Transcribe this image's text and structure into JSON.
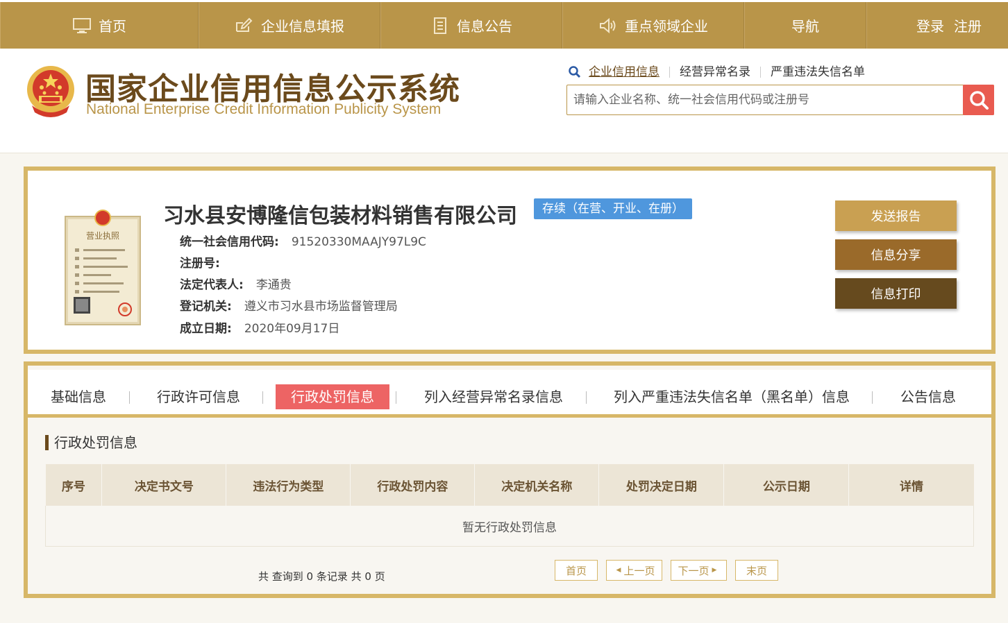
{
  "nav": {
    "home": "首页",
    "report": "企业信息填报",
    "notice": "信息公告",
    "key": "重点领域企业",
    "guide": "导航",
    "login": "登录",
    "register": "注册"
  },
  "header": {
    "title": "国家企业信用信息公示系统",
    "subtitle": "National Enterprise Credit Information Publicity System",
    "search_tabs": [
      "企业信用信息",
      "经营异常名录",
      "严重违法失信名单"
    ],
    "search_placeholder": "请输入企业名称、统一社会信用代码或注册号"
  },
  "company": {
    "name": "习水县安博隆信包装材料销售有限公司",
    "status": "存续（在营、开业、在册）",
    "credit_code_label": "统一社会信用代码:",
    "credit_code": "91520330MAAJY97L9C",
    "reg_no_label": "注册号:",
    "reg_no": "",
    "legal_rep_label": "法定代表人:",
    "legal_rep": "李通贵",
    "authority_label": "登记机关:",
    "authority": "遵义市习水县市场监督管理局",
    "est_date_label": "成立日期:",
    "est_date": "2020年09月17日",
    "license_text": "营业执照"
  },
  "actions": {
    "send": "发送报告",
    "share": "信息分享",
    "print": "信息打印"
  },
  "tabs": [
    "基础信息",
    "行政许可信息",
    "行政处罚信息",
    "列入经营异常名录信息",
    "列入严重违法失信名单（黑名单）信息",
    "公告信息"
  ],
  "section": {
    "title": "行政处罚信息",
    "columns": [
      "序号",
      "决定书文号",
      "违法行为类型",
      "行政处罚内容",
      "决定机关名称",
      "处罚决定日期",
      "公示日期",
      "详情"
    ],
    "empty": "暂无行政处罚信息"
  },
  "pagination": {
    "info": "共 查询到 0 条记录 共 0 页",
    "first": "首页",
    "prev": "上一页",
    "next": "下一页",
    "last": "末页"
  },
  "colors": {
    "nav_bg": "#b99549",
    "border_gold": "#d7b768",
    "status_blue": "#4f97dd",
    "active_tab": "#ed6464",
    "send_btn": "#c9a052",
    "share_btn": "#9a6a2a",
    "print_btn": "#664a1e"
  }
}
